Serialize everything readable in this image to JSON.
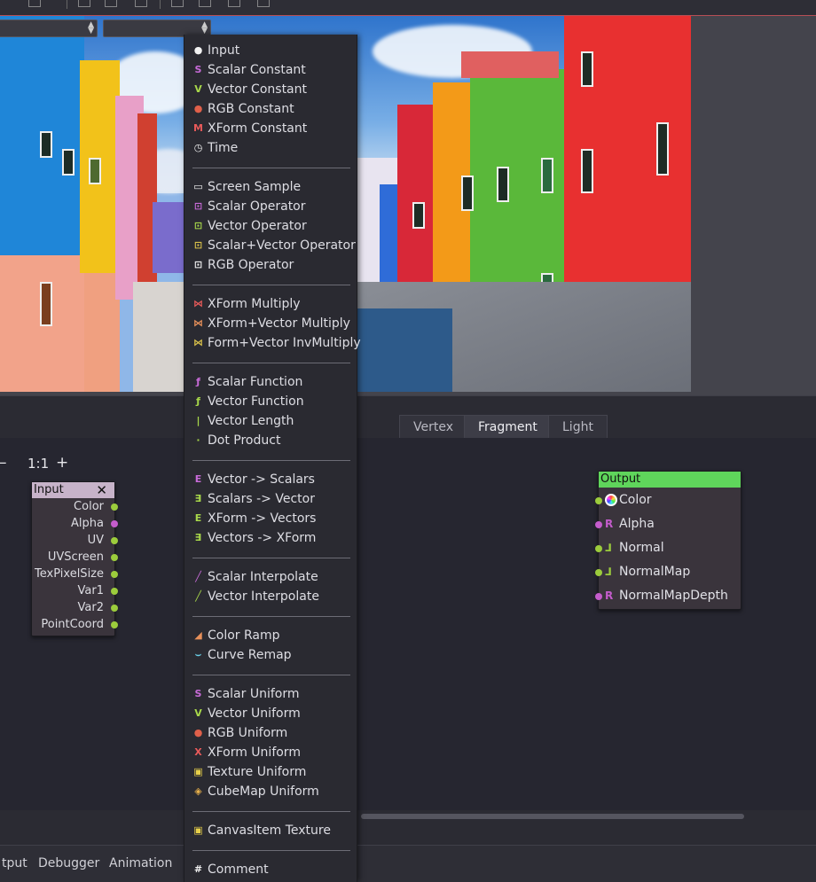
{
  "tabs": [
    "Vertex",
    "Fragment",
    "Light"
  ],
  "active_tab": "Fragment",
  "zoom": {
    "minus": "–",
    "reset": "1:1",
    "plus": "+"
  },
  "input_node": {
    "title": "Input",
    "close": "✕",
    "ports": [
      "Color",
      "Alpha",
      "UV",
      "UVScreen",
      "TexPixelSize",
      "Var1",
      "Var2",
      "PointCoord"
    ],
    "port_colors": [
      "#9ccc3c",
      "#c45ccc",
      "#9ccc3c",
      "#9ccc3c",
      "#9ccc3c",
      "#9ccc3c",
      "#9ccc3c",
      "#9ccc3c"
    ]
  },
  "output_node": {
    "title": "Output",
    "ports": [
      "Color",
      "Alpha",
      "Normal",
      "NormalMap",
      "NormalMapDepth"
    ],
    "port_icons": [
      "rgb-wheel-icon",
      "scalar-r-icon",
      "vector-normal-icon",
      "vector-normal-icon",
      "scalar-r-icon"
    ],
    "port_colors": [
      "#9ccc3c",
      "#c45ccc",
      "#9ccc3c",
      "#9ccc3c",
      "#c45ccc"
    ]
  },
  "bottom_tabs": [
    "tput",
    "Debugger",
    "Animation"
  ],
  "menu": {
    "groups": [
      [
        {
          "label": "Input",
          "icon": "circle-icon",
          "glyph": "●",
          "color": "#f2f2f2"
        },
        {
          "label": "Scalar Constant",
          "icon": "scalar-icon",
          "glyph": "S",
          "color": "#c86bd8"
        },
        {
          "label": "Vector Constant",
          "icon": "vector-icon",
          "glyph": "V",
          "color": "#a8d84a"
        },
        {
          "label": "RGB Constant",
          "icon": "rgb-icon",
          "glyph": "●",
          "color": "#e0604a"
        },
        {
          "label": "XForm Constant",
          "icon": "xform-icon",
          "glyph": "M",
          "color": "#e85a5a"
        },
        {
          "label": "Time",
          "icon": "clock-icon",
          "glyph": "◷",
          "color": "#f2f2f2"
        }
      ],
      [
        {
          "label": "Screen Sample",
          "icon": "screen-icon",
          "glyph": "▭",
          "color": "#f2f2f2"
        },
        {
          "label": "Scalar Operator",
          "icon": "scalar-op-icon",
          "glyph": "⊡",
          "color": "#c86bd8"
        },
        {
          "label": "Vector Operator",
          "icon": "vector-op-icon",
          "glyph": "⊡",
          "color": "#a8d84a"
        },
        {
          "label": "Scalar+Vector Operator",
          "icon": "scalar-vector-op-icon",
          "glyph": "⊡",
          "color": "#d8c04a"
        },
        {
          "label": "RGB Operator",
          "icon": "rgb-op-icon",
          "glyph": "⊡",
          "color": "#f2f2f2"
        }
      ],
      [
        {
          "label": "XForm Multiply",
          "icon": "xform-multiply-icon",
          "glyph": "⋈",
          "color": "#e85a5a"
        },
        {
          "label": "XForm+Vector Multiply",
          "icon": "xform-vector-multiply-icon",
          "glyph": "⋈",
          "color": "#e8905a"
        },
        {
          "label": "Form+Vector InvMultiply",
          "icon": "xform-vector-invmultiply-icon",
          "glyph": "⋈",
          "color": "#d8c04a"
        }
      ],
      [
        {
          "label": "Scalar Function",
          "icon": "scalar-function-icon",
          "glyph": "ƒ",
          "color": "#c86bd8"
        },
        {
          "label": "Vector Function",
          "icon": "vector-function-icon",
          "glyph": "ƒ",
          "color": "#a8d84a"
        },
        {
          "label": "Vector Length",
          "icon": "vector-length-icon",
          "glyph": "|",
          "color": "#a8d84a"
        },
        {
          "label": "Dot Product",
          "icon": "dot-product-icon",
          "glyph": "·",
          "color": "#a8d84a"
        }
      ],
      [
        {
          "label": "Vector -> Scalars",
          "icon": "vector-to-scalars-icon",
          "glyph": "E",
          "color": "#c86bd8"
        },
        {
          "label": "Scalars -> Vector",
          "icon": "scalars-to-vector-icon",
          "glyph": "∃",
          "color": "#a8d84a"
        },
        {
          "label": "XForm -> Vectors",
          "icon": "xform-to-vectors-icon",
          "glyph": "E",
          "color": "#a8d84a"
        },
        {
          "label": "Vectors -> XForm",
          "icon": "vectors-to-xform-icon",
          "glyph": "∃",
          "color": "#a8d84a"
        }
      ],
      [
        {
          "label": "Scalar Interpolate",
          "icon": "scalar-interpolate-icon",
          "glyph": "╱",
          "color": "#c86bd8"
        },
        {
          "label": "Vector Interpolate",
          "icon": "vector-interpolate-icon",
          "glyph": "╱",
          "color": "#a8d84a"
        }
      ],
      [
        {
          "label": "Color Ramp",
          "icon": "color-ramp-icon",
          "glyph": "◢",
          "color": "#e8905a"
        },
        {
          "label": "Curve Remap",
          "icon": "curve-remap-icon",
          "glyph": "⌣",
          "color": "#6ad0e8"
        }
      ],
      [
        {
          "label": "Scalar Uniform",
          "icon": "scalar-uniform-icon",
          "glyph": "S",
          "color": "#c86bd8"
        },
        {
          "label": "Vector Uniform",
          "icon": "vector-uniform-icon",
          "glyph": "V",
          "color": "#a8d84a"
        },
        {
          "label": "RGB Uniform",
          "icon": "rgb-uniform-icon",
          "glyph": "●",
          "color": "#e0604a"
        },
        {
          "label": "XForm Uniform",
          "icon": "xform-uniform-icon",
          "glyph": "X",
          "color": "#e85a5a"
        },
        {
          "label": "Texture Uniform",
          "icon": "texture-uniform-icon",
          "glyph": "▣",
          "color": "#e8d04a"
        },
        {
          "label": "CubeMap Uniform",
          "icon": "cubemap-uniform-icon",
          "glyph": "◈",
          "color": "#e8b04a"
        }
      ],
      [
        {
          "label": "CanvasItem Texture",
          "icon": "canvasitem-texture-icon",
          "glyph": "▣",
          "color": "#e8d04a"
        }
      ],
      [
        {
          "label": "Comment",
          "icon": "comment-icon",
          "glyph": "#",
          "color": "#f2f2f2"
        }
      ]
    ]
  }
}
